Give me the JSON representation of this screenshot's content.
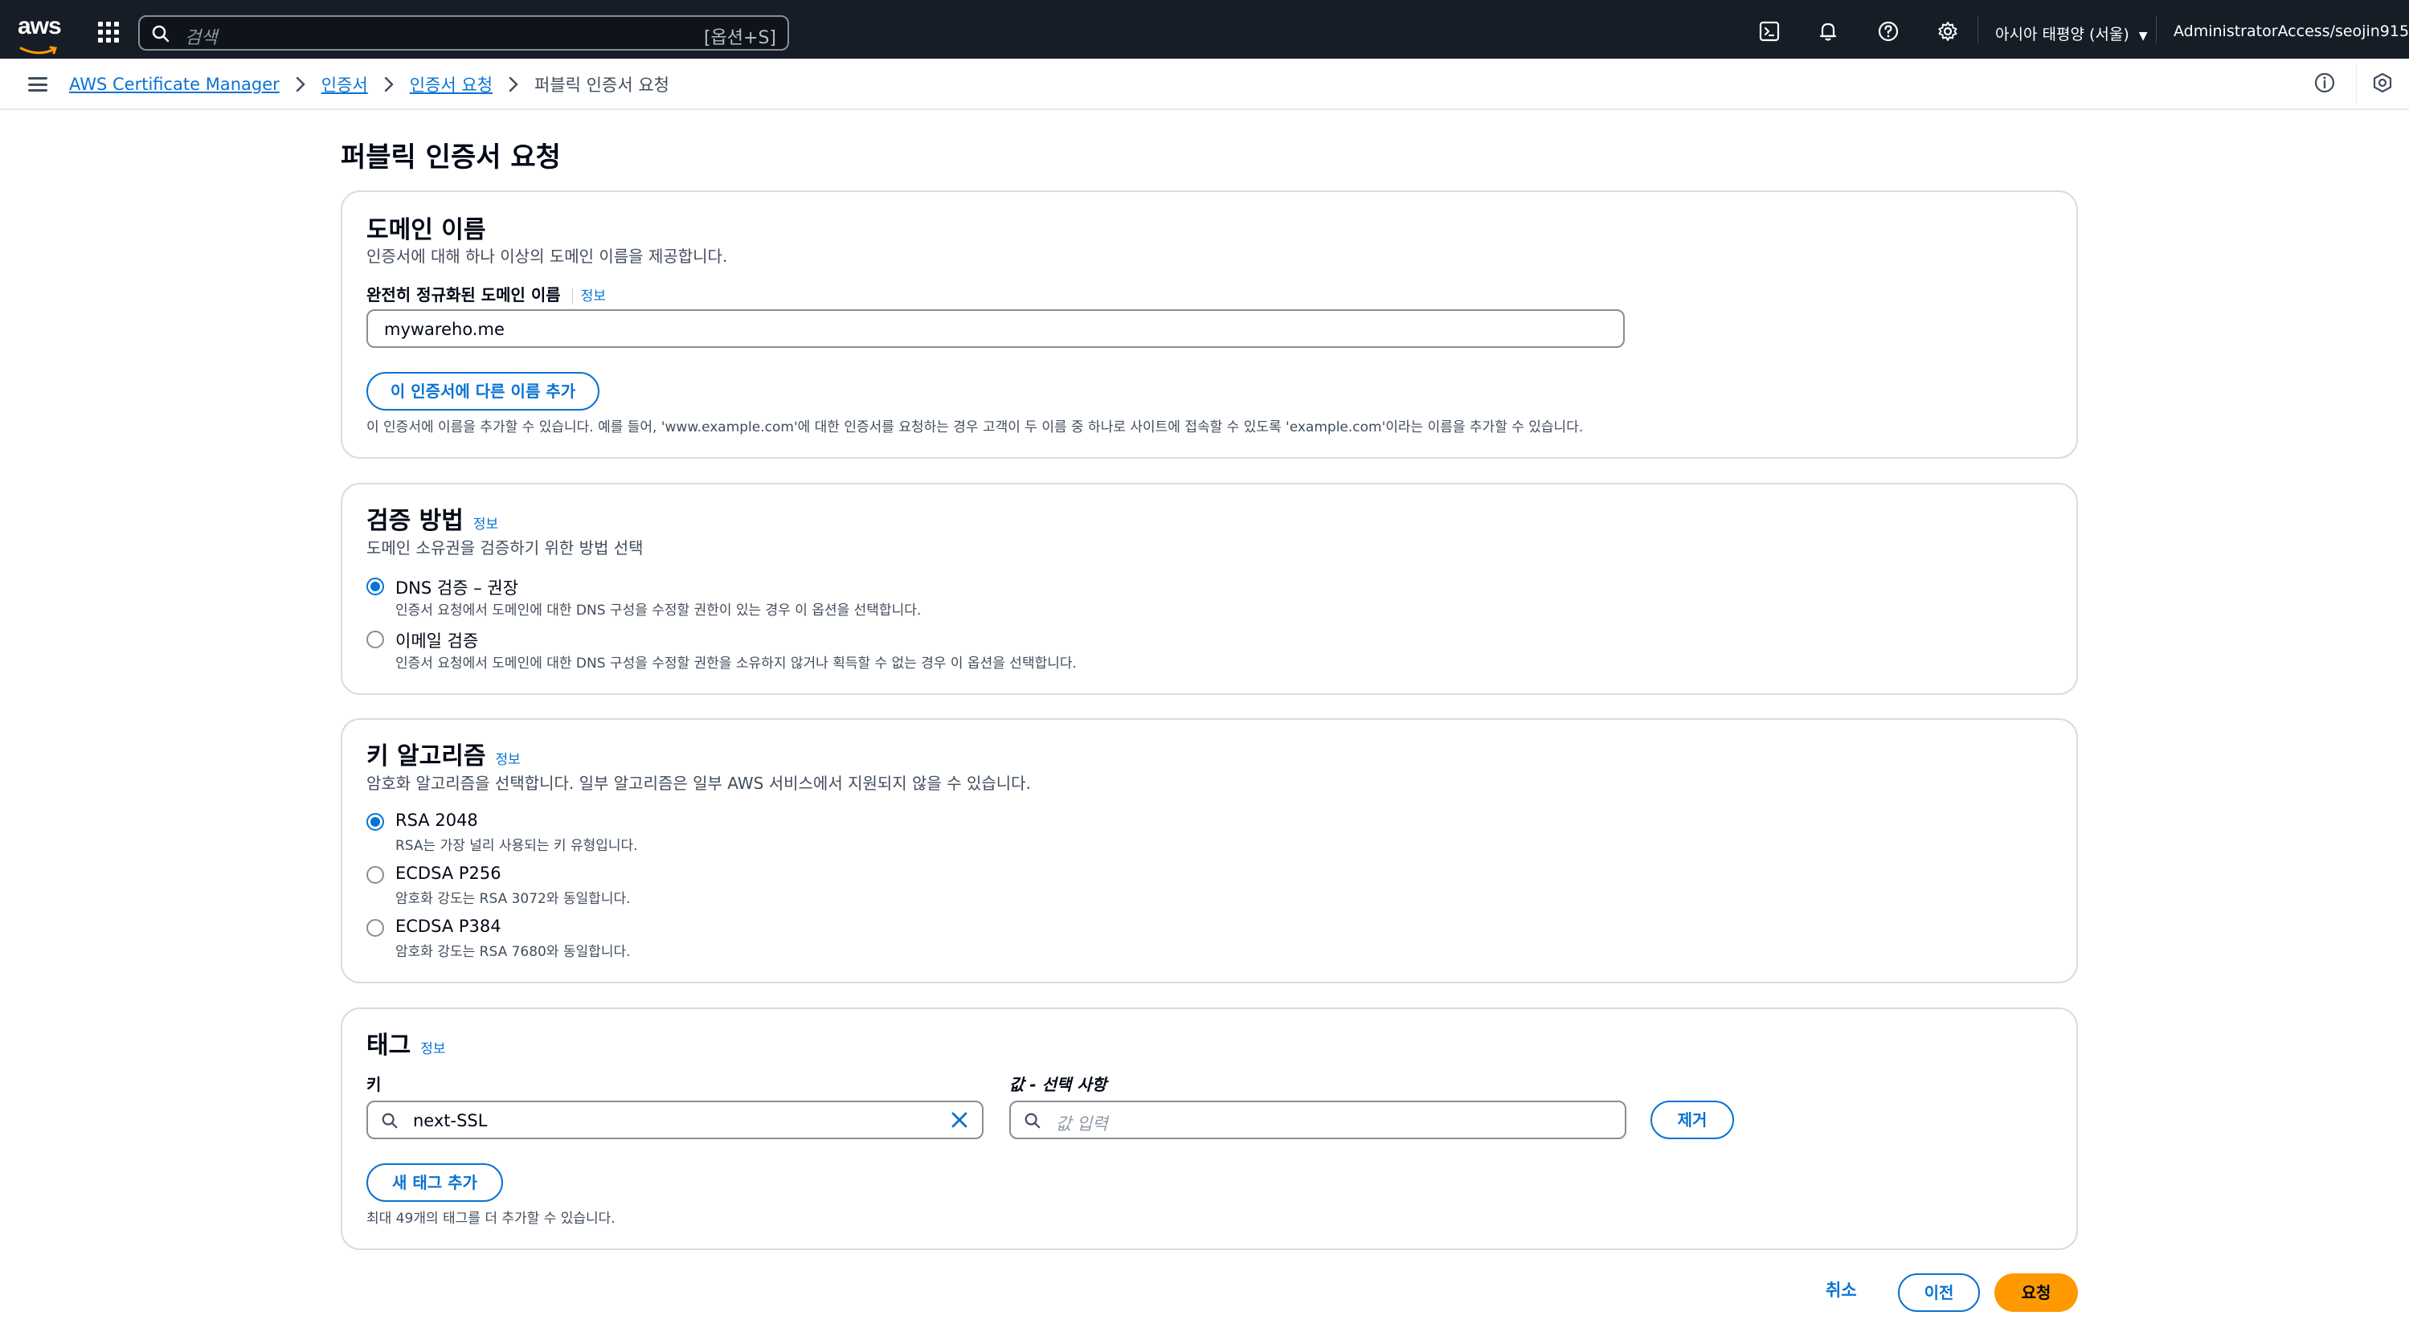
{
  "topnav": {
    "logo_text": "aws",
    "search_placeholder": "검색",
    "search_shortcut": "[옵션+S]",
    "region": "아시아 태평양 (서울)",
    "account": "AdministratorAccess/seojin915",
    "icons": [
      "cloudshell-icon",
      "bell-icon",
      "help-icon",
      "gear-icon"
    ]
  },
  "breadcrumb": {
    "items": [
      "AWS Certificate Manager",
      "인증서",
      "인증서 요청"
    ],
    "current": "퍼블릭 인증서 요청"
  },
  "page": {
    "title": "퍼블릭 인증서 요청"
  },
  "domain_section": {
    "title": "도메인 이름",
    "description": "인증서에 대해 하나 이상의 도메인 이름을 제공합니다.",
    "field_label": "완전히 정규화된 도메인 이름",
    "info": "정보",
    "domain_value": "mywareho.me",
    "add_button": "이 인증서에 다른 이름 추가",
    "hint": "이 인증서에 이름을 추가할 수 있습니다. 예를 들어, 'www.example.com'에 대한 인증서를 요청하는 경우 고객이 두 이름 중 하나로 사이트에 접속할 수 있도록 'example.com'이라는 이름을 추가할 수 있습니다."
  },
  "validation_section": {
    "title": "검증 방법",
    "info": "정보",
    "description": "도메인 소유권을 검증하기 위한 방법 선택",
    "options": [
      {
        "label": "DNS 검증 – 권장",
        "desc": "인증서 요청에서 도메인에 대한 DNS 구성을 수정할 권한이 있는 경우 이 옵션을 선택합니다.",
        "selected": true
      },
      {
        "label": "이메일 검증",
        "desc": "인증서 요청에서 도메인에 대한 DNS 구성을 수정할 권한을 소유하지 않거나 획득할 수 없는 경우 이 옵션을 선택합니다.",
        "selected": false
      }
    ]
  },
  "key_section": {
    "title": "키 알고리즘",
    "info": "정보",
    "description": "암호화 알고리즘을 선택합니다. 일부 알고리즘은 일부 AWS 서비스에서 지원되지 않을 수 있습니다.",
    "options": [
      {
        "label": "RSA 2048",
        "desc": "RSA는 가장 널리 사용되는 키 유형입니다.",
        "selected": true
      },
      {
        "label": "ECDSA P256",
        "desc": "암호화 강도는 RSA 3072와 동일합니다.",
        "selected": false
      },
      {
        "label": "ECDSA P384",
        "desc": "암호화 강도는 RSA 7680와 동일합니다.",
        "selected": false
      }
    ]
  },
  "tags_section": {
    "title": "태그",
    "info": "정보",
    "key_label": "키",
    "value_label": "값 - 선택 사항",
    "key_value": "next-SSL",
    "value_placeholder": "값 입력",
    "remove_button": "제거",
    "add_button": "새 태그 추가",
    "hint": "최대 49개의 태그를 더 추가할 수 있습니다."
  },
  "footer": {
    "cancel": "취소",
    "previous": "이전",
    "submit": "요청"
  },
  "colors": {
    "nav_bg": "#161d26",
    "link": "#0972d3",
    "primary": "#ff9900",
    "border": "#d8dbe0"
  }
}
